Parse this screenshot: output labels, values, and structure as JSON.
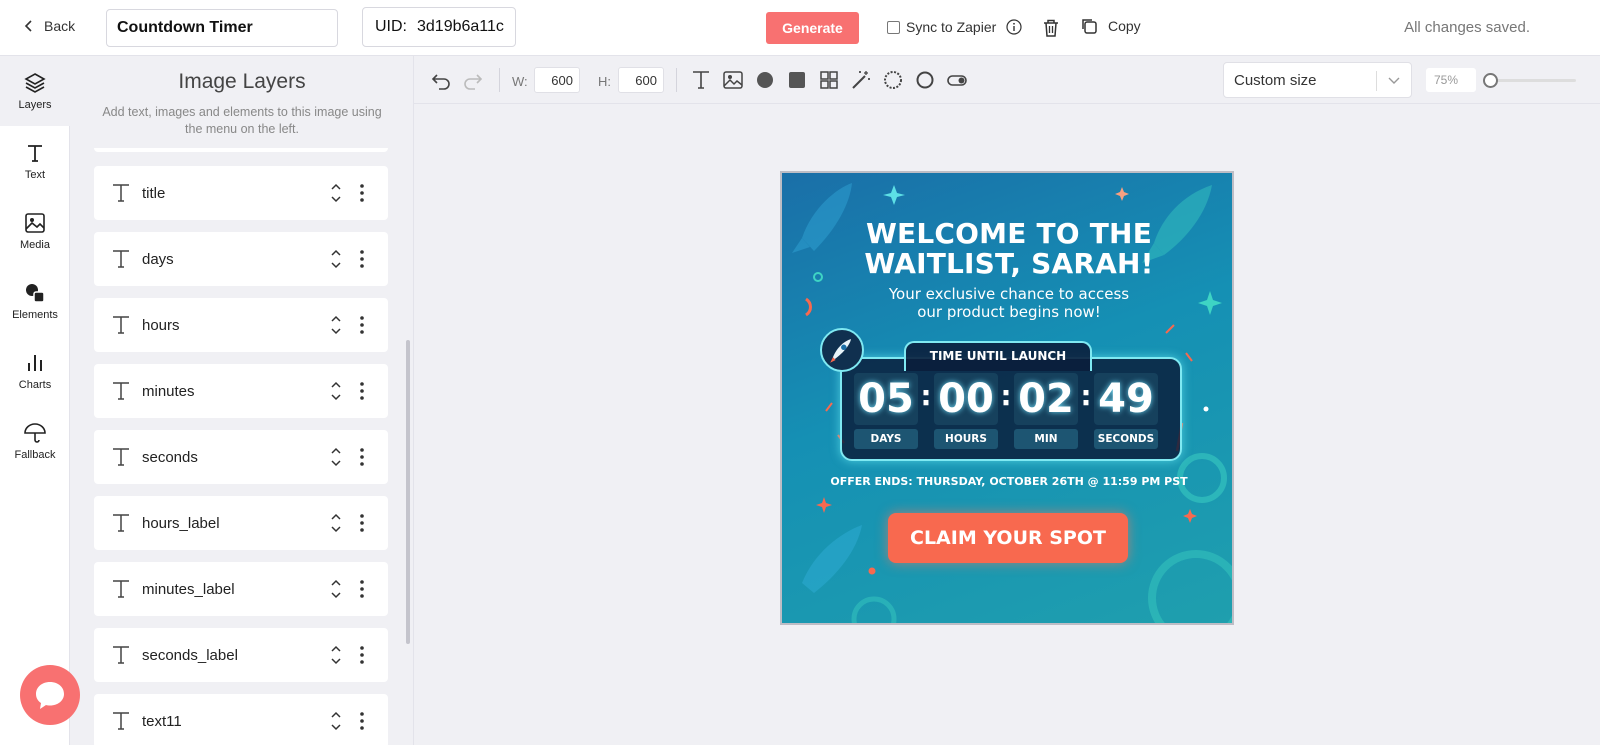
{
  "header": {
    "back_label": "Back",
    "project_name": "Countdown Timer",
    "uid_label": "UID:",
    "uid_value": "3d19b6a11c",
    "generate_label": "Generate",
    "sync_label": "Sync to Zapier",
    "copy_label": "Copy",
    "status": "All changes saved."
  },
  "rail": {
    "items": [
      {
        "label": "Layers",
        "icon": "layers-icon"
      },
      {
        "label": "Text",
        "icon": "text-icon"
      },
      {
        "label": "Media",
        "icon": "image-icon"
      },
      {
        "label": "Elements",
        "icon": "shapes-icon"
      },
      {
        "label": "Charts",
        "icon": "bar-chart-icon"
      },
      {
        "label": "Fallback",
        "icon": "umbrella-icon"
      }
    ]
  },
  "panel": {
    "title": "Image Layers",
    "description": "Add text, images and elements to this image using the menu on the left.",
    "layers": [
      "title",
      "days",
      "hours",
      "minutes",
      "seconds",
      "hours_label",
      "minutes_label",
      "seconds_label",
      "text11"
    ]
  },
  "toolbar": {
    "width_label": "W:",
    "width_value": "600",
    "height_label": "H:",
    "height_value": "600",
    "size_preset": "Custom size",
    "zoom": "75%"
  },
  "canvas": {
    "headline_line1": "WELCOME TO THE",
    "headline_line2": "WAITLIST, SARAH!",
    "sub_line1": "Your exclusive chance to access",
    "sub_line2": "our product begins now!",
    "timer_title": "TIME UNTIL LAUNCH",
    "days": "05",
    "hours": "00",
    "minutes": "02",
    "seconds": "49",
    "days_label": "DAYS",
    "hours_label": "HOURS",
    "minutes_label": "MIN",
    "seconds_label": "SECONDS",
    "offer": "OFFER ENDS: THURSDAY, OCTOBER 26TH @ 11:59 PM PST",
    "cta": "CLAIM YOUR SPOT"
  },
  "colors": {
    "accent": "#f87171",
    "cta": "#f8694f",
    "neon": "#7fe9f2"
  }
}
